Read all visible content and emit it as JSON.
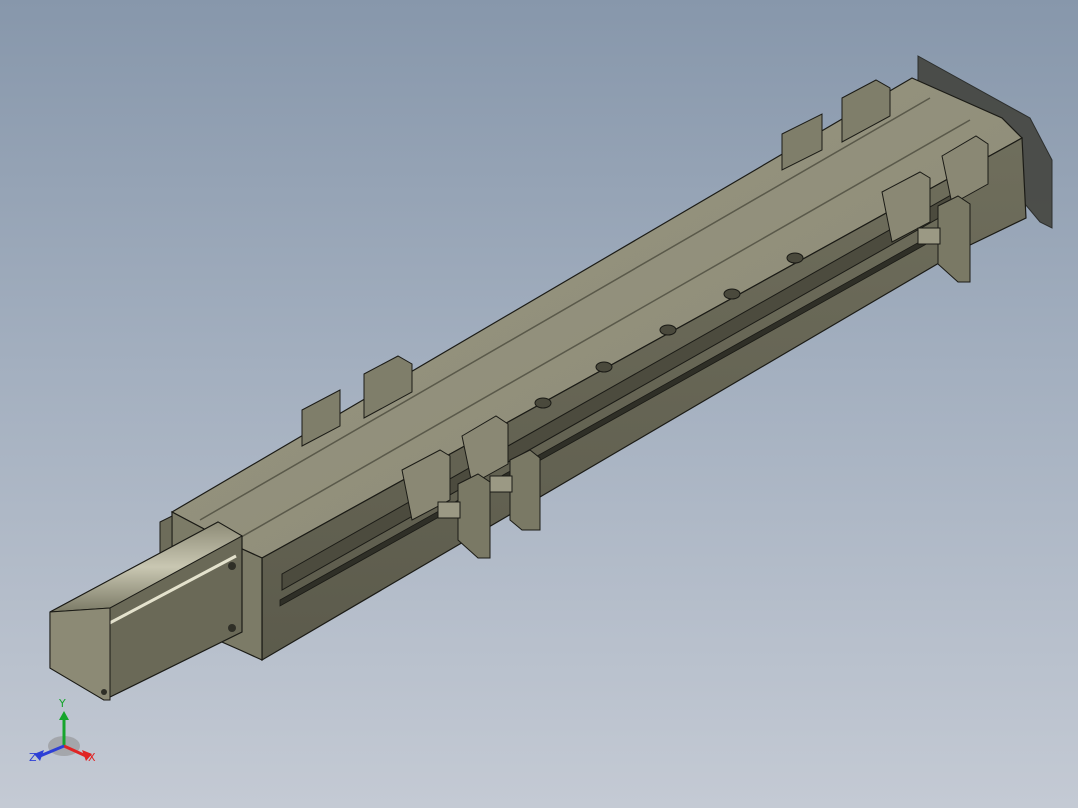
{
  "viewport": {
    "background_top": "#8797ab",
    "background_bottom": "#c4cad4",
    "model_color": "#84836f",
    "model_dark": "#5e5d4e",
    "model_light": "#a19f89",
    "edge_color": "#1b1b16"
  },
  "triad": {
    "icon": "xyz-axis-triad-icon",
    "x_label": "X",
    "y_label": "Y",
    "z_label": "Z",
    "x_color": "#e02424",
    "y_color": "#16a52c",
    "z_color": "#2d3fd6"
  }
}
